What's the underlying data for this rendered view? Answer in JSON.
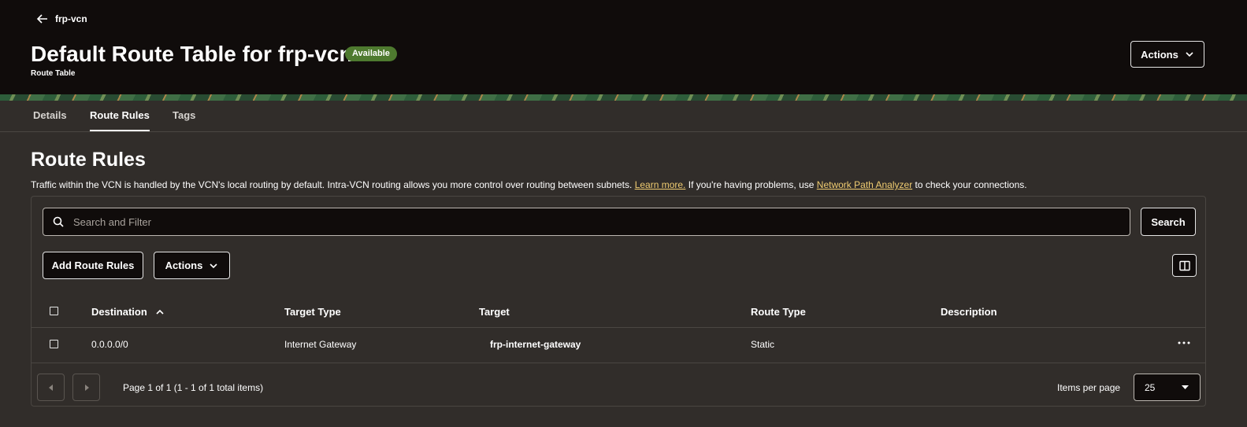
{
  "header": {
    "back_label": "frp-vcn",
    "title": "Default Route Table for frp-vcn",
    "status": "Available",
    "subtitle": "Route Table",
    "actions_label": "Actions"
  },
  "tabs": [
    {
      "label": "Details",
      "active": false
    },
    {
      "label": "Route Rules",
      "active": true
    },
    {
      "label": "Tags",
      "active": false
    }
  ],
  "section": {
    "title": "Route Rules",
    "description_part1": "Traffic within the VCN is handled by the VCN's local routing by default. Intra-VCN routing allows you more control over routing between subnets.",
    "learn_more": "Learn more.",
    "description_part2": "If you're having problems, use",
    "analyzer_link": "Network Path Analyzer",
    "description_part3": "to check your connections."
  },
  "search": {
    "placeholder": "Search and Filter",
    "button_label": "Search"
  },
  "toolbar": {
    "add_label": "Add Route Rules",
    "actions_label": "Actions"
  },
  "table": {
    "columns": [
      "Destination",
      "Target Type",
      "Target",
      "Route Type",
      "Description"
    ],
    "rows": [
      {
        "destination": "0.0.0.0/0",
        "target_type": "Internet Gateway",
        "target": "frp-internet-gateway",
        "route_type": "Static",
        "description": ""
      }
    ]
  },
  "pagination": {
    "info": "Page 1 of 1 (1 - 1 of 1 total items)",
    "items_per_page_label": "Items per page",
    "items_per_page": "25"
  },
  "colors": {
    "header_bg": "#100c0b",
    "body_bg": "#312d2a",
    "badge": "#4e7a2f",
    "link": "#f0cc71"
  }
}
